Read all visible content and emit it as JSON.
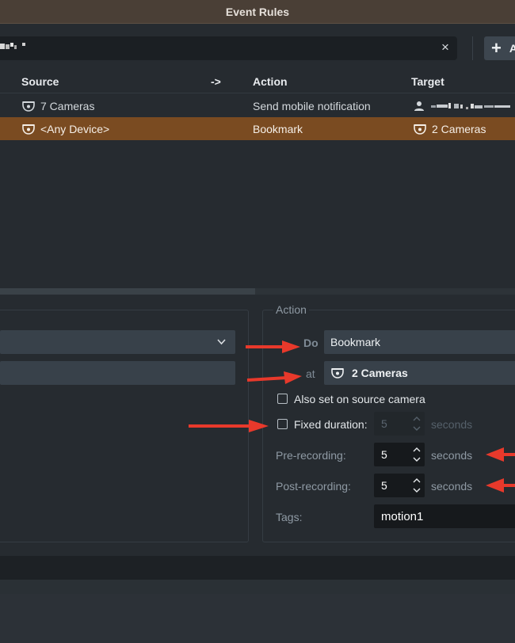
{
  "window": {
    "title": "Event Rules"
  },
  "search": {
    "clear_glyph": "×"
  },
  "toolbar": {
    "add_label": "A",
    "add_glyph": "+"
  },
  "table": {
    "columns": {
      "source": "Source",
      "arrow": "->",
      "action": "Action",
      "target": "Target"
    },
    "rows": [
      {
        "source_icon": "camera-icon",
        "source": "7 Cameras",
        "action": "Send mobile notification",
        "target_icon": "user-icon",
        "target": "",
        "selected": false
      },
      {
        "source_icon": "camera-icon",
        "source": "<Any Device>",
        "action": "Bookmark",
        "target_icon": "camera-icon",
        "target": "2 Cameras",
        "selected": true
      }
    ]
  },
  "action_panel": {
    "title": "Action",
    "do_label": "Do",
    "do_value": "Bookmark",
    "at_label": "at",
    "at_value": "2 Cameras",
    "also_set_label": "Also set on source camera",
    "also_set_checked": false,
    "fixed_duration_label": "Fixed duration:",
    "fixed_duration_checked": false,
    "fixed_duration_value": "5",
    "fixed_duration_unit": "seconds",
    "pre_label": "Pre-recording:",
    "pre_value": "5",
    "pre_unit": "seconds",
    "post_label": "Post-recording:",
    "post_value": "5",
    "post_unit": "seconds",
    "tags_label": "Tags:",
    "tags_value": "motion1"
  },
  "event_panel": {
    "chevron": "chevron-down-icon"
  },
  "colors": {
    "accent_row": "#7a4b21",
    "annotation_arrow": "#e8392b",
    "field_bg": "#38414a"
  }
}
